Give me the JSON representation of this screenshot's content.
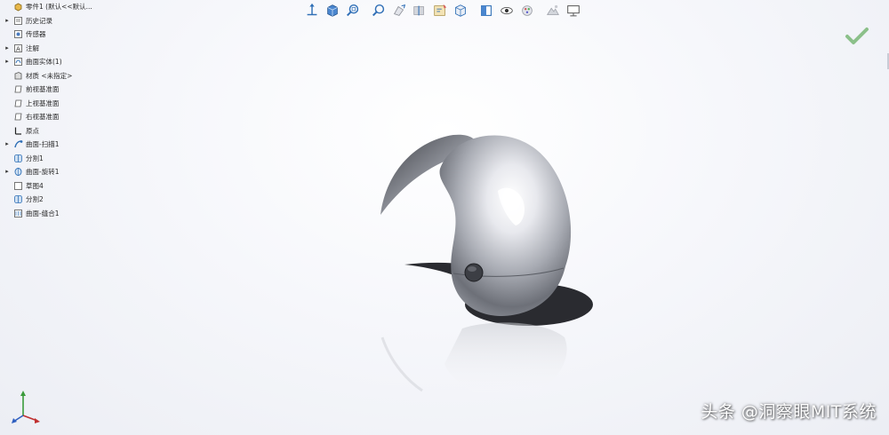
{
  "feature_tree": {
    "items": [
      {
        "label": "零件1 (默认<<默认...",
        "icon": "part-icon",
        "expander": "",
        "indent": 0
      },
      {
        "label": "历史记录",
        "icon": "history-icon",
        "expander": "▸",
        "indent": 0
      },
      {
        "label": "传感器",
        "icon": "sensor-icon",
        "expander": "",
        "indent": 0
      },
      {
        "label": "注解",
        "icon": "annotation-icon",
        "expander": "▸",
        "indent": 0
      },
      {
        "label": "曲面实体(1)",
        "icon": "surface-body-folder-icon",
        "expander": "▸",
        "indent": 0
      },
      {
        "label": "材质 <未指定>",
        "icon": "material-icon",
        "expander": "",
        "indent": 0
      },
      {
        "label": "前视基准面",
        "icon": "plane-icon",
        "expander": "",
        "indent": 0
      },
      {
        "label": "上视基准面",
        "icon": "plane-icon",
        "expander": "",
        "indent": 0
      },
      {
        "label": "右视基准面",
        "icon": "plane-icon",
        "expander": "",
        "indent": 0
      },
      {
        "label": "原点",
        "icon": "origin-icon",
        "expander": "",
        "indent": 0
      },
      {
        "label": "曲面-扫描1",
        "icon": "sweep-surface-icon",
        "expander": "▸",
        "indent": 0
      },
      {
        "label": "分割1",
        "icon": "split-icon",
        "expander": "",
        "indent": 0
      },
      {
        "label": "曲面-旋转1",
        "icon": "revolve-surface-icon",
        "expander": "▸",
        "indent": 0
      },
      {
        "label": "草图4",
        "icon": "sketch-icon",
        "expander": "",
        "indent": 0
      },
      {
        "label": "分割2",
        "icon": "split-icon",
        "expander": "",
        "indent": 0
      },
      {
        "label": "曲面-缝合1",
        "icon": "knit-surface-icon",
        "expander": "",
        "indent": 0
      }
    ]
  },
  "toolbar": {
    "buttons": [
      "view-orientation-icon",
      "cube-view-icon",
      "zoom-to-fit-icon",
      "zoom-to-area-icon",
      "previous-view-icon",
      "section-view-icon",
      "dynamic-annotation-icon",
      "view-settings-icon",
      "display-style-icon",
      "hide-show-items-icon",
      "edit-appearance-icon",
      "apply-scene-icon",
      "monitor-view-icon"
    ]
  },
  "watermark": {
    "text": "头条 @洞察眼MIT系统"
  },
  "colors": {
    "toolbar_blue": "#2f6fb6",
    "confirm_green": "#8cc08a",
    "tree_text": "#2a2a2a",
    "model_metal": "#b9bcc4"
  }
}
